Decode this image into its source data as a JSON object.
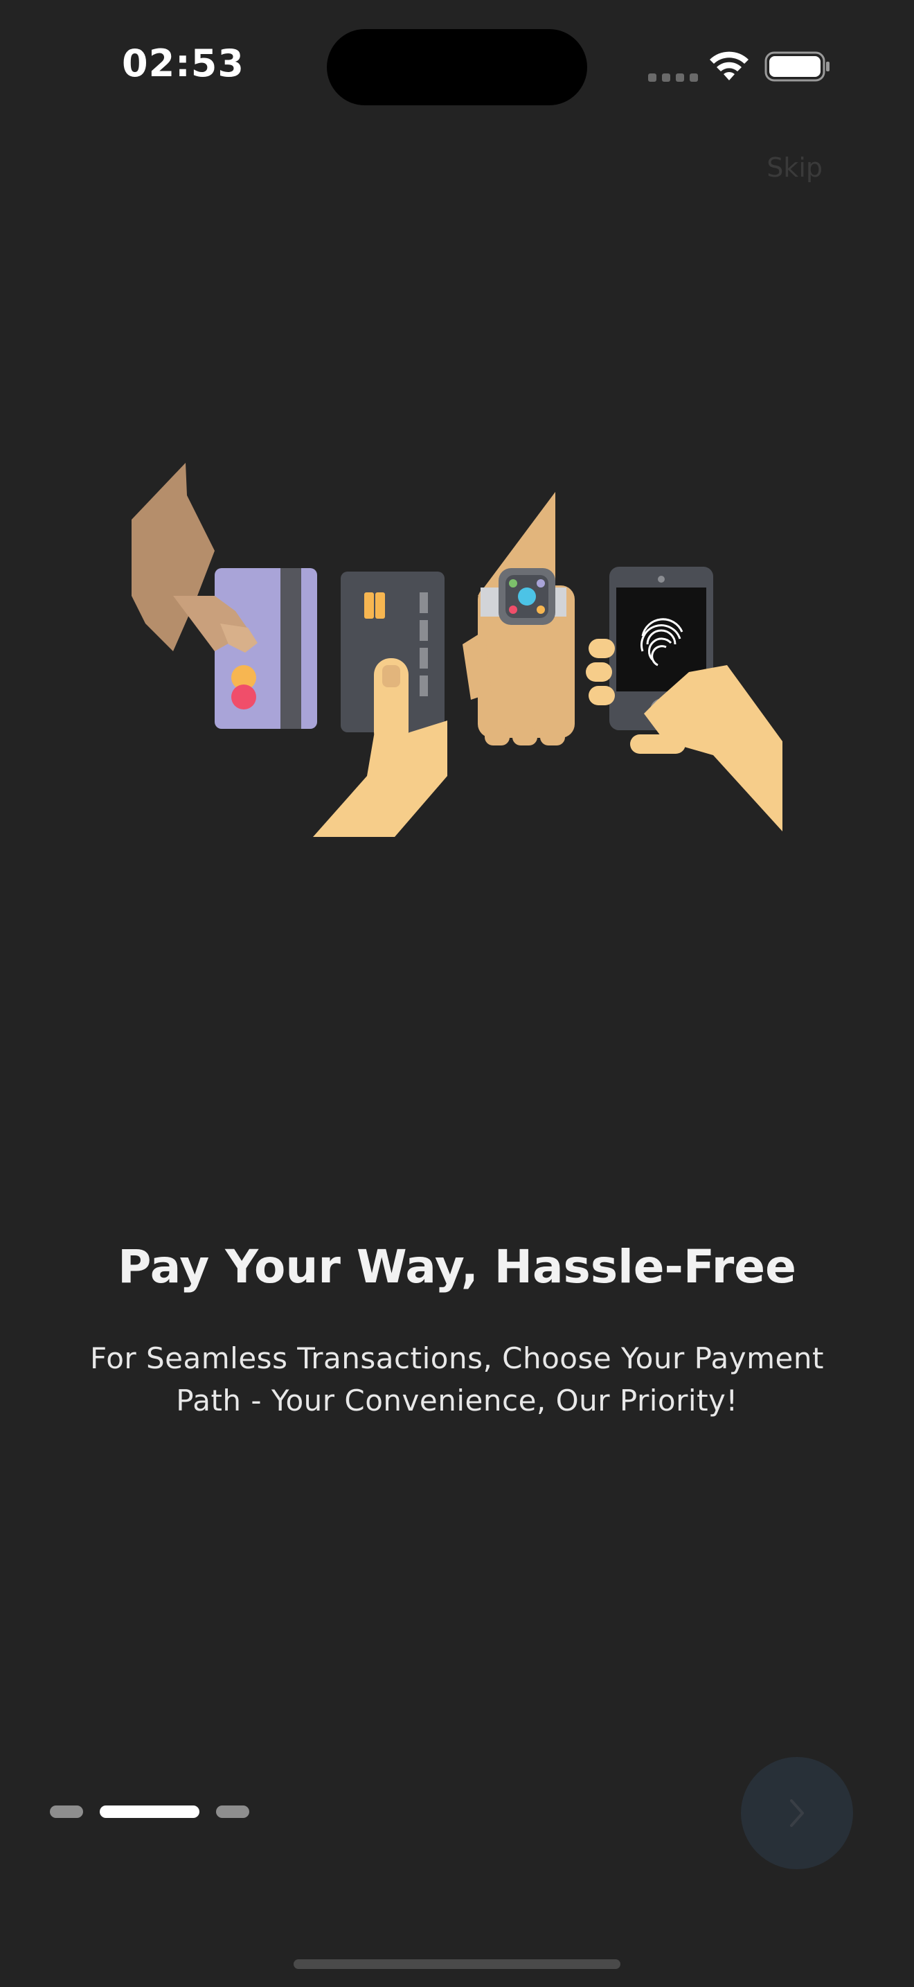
{
  "status_bar": {
    "time": "02:53"
  },
  "header": {
    "skip_label": "Skip"
  },
  "onboarding": {
    "title": "Pay Your Way, Hassle-Free",
    "subtitle": "For Seamless Transactions, Choose Your Payment Path - Your Convenience, Our Priority!"
  },
  "pager": {
    "total_pages": 3,
    "current_page": 2
  },
  "icons": {
    "wifi": "wifi-icon",
    "battery": "battery-icon",
    "next": "chevron-right-icon"
  },
  "colors": {
    "background": "#232323",
    "skin_light": "#f6cd8a",
    "skin_medium": "#e2b57c",
    "skin_dark": "#b58e6b",
    "card_purple": "#a9a4d8",
    "card_dark": "#4b4e55",
    "next_button": "#283038"
  }
}
